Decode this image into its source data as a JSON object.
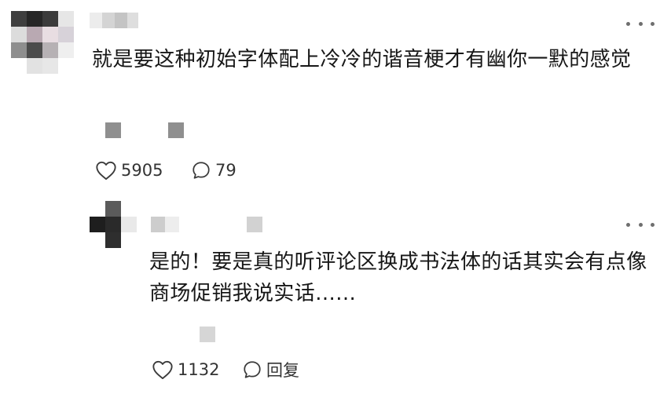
{
  "colors": {
    "text": "#171717",
    "secondary": "#333333",
    "icon_stroke": "#3a3a3a",
    "more_dots": "#6f6f6f"
  },
  "comments": [
    {
      "text": "就是要这种初始字体配上冷冷的谐音梗才有幽你一默的感觉",
      "likes": "5905",
      "replies": "79",
      "icons": [
        "heart-icon",
        "comment-bubble-icon",
        "more-icon"
      ]
    },
    {
      "text": "是的！要是真的听评论区换成书法体的话其实会有点像商场促销我说实话......",
      "likes": "1132",
      "reply_label": "回复",
      "icons": [
        "heart-icon",
        "comment-bubble-icon",
        "more-icon"
      ]
    }
  ]
}
